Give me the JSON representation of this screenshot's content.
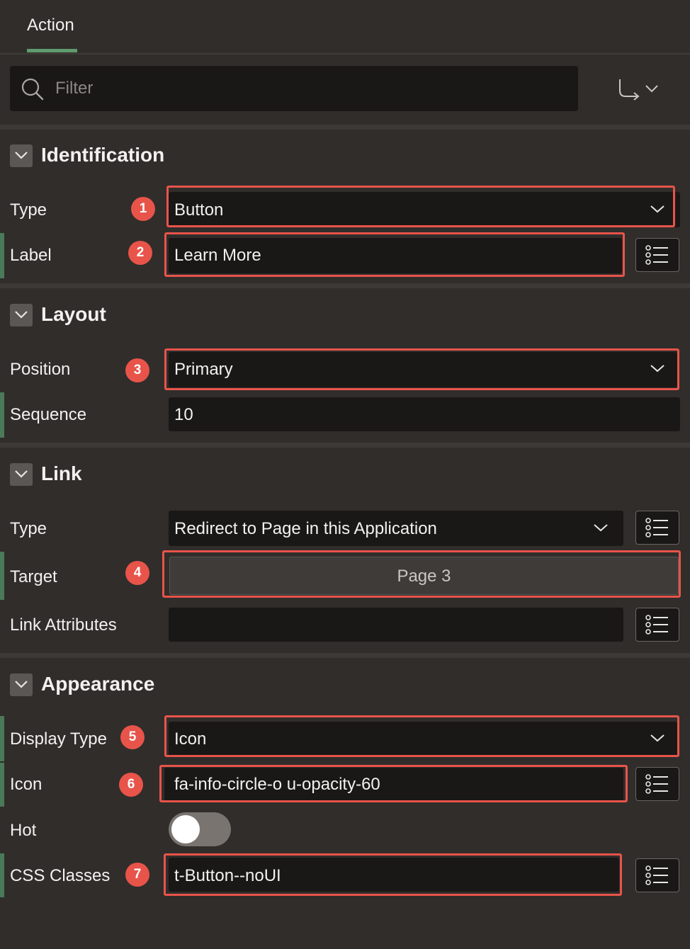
{
  "tabs": {
    "action": "Action"
  },
  "filter": {
    "placeholder": "Filter"
  },
  "sections": {
    "identification": {
      "title": "Identification",
      "type_label": "Type",
      "type_value": "Button",
      "label_label": "Label",
      "label_value": "Learn More"
    },
    "layout": {
      "title": "Layout",
      "position_label": "Position",
      "position_value": "Primary",
      "sequence_label": "Sequence",
      "sequence_value": "10"
    },
    "link": {
      "title": "Link",
      "type_label": "Type",
      "type_value": "Redirect to Page in this Application",
      "target_label": "Target",
      "target_value": "Page 3",
      "attributes_label": "Link Attributes",
      "attributes_value": ""
    },
    "appearance": {
      "title": "Appearance",
      "display_type_label": "Display Type",
      "display_type_value": "Icon",
      "icon_label": "Icon",
      "icon_value": "fa-info-circle-o u-opacity-60",
      "hot_label": "Hot",
      "hot_value": false,
      "css_classes_label": "CSS Classes",
      "css_classes_value": "t-Button--noUI"
    }
  },
  "badges": [
    "1",
    "2",
    "3",
    "4",
    "5",
    "6",
    "7"
  ],
  "colors": {
    "highlight": "#e8544a",
    "accent": "#5f9b6f",
    "background": "#302d2b",
    "field": "#1a1817"
  },
  "icons": [
    "search-icon",
    "goto-group-icon",
    "chevron-down-icon",
    "list-picker-icon"
  ]
}
